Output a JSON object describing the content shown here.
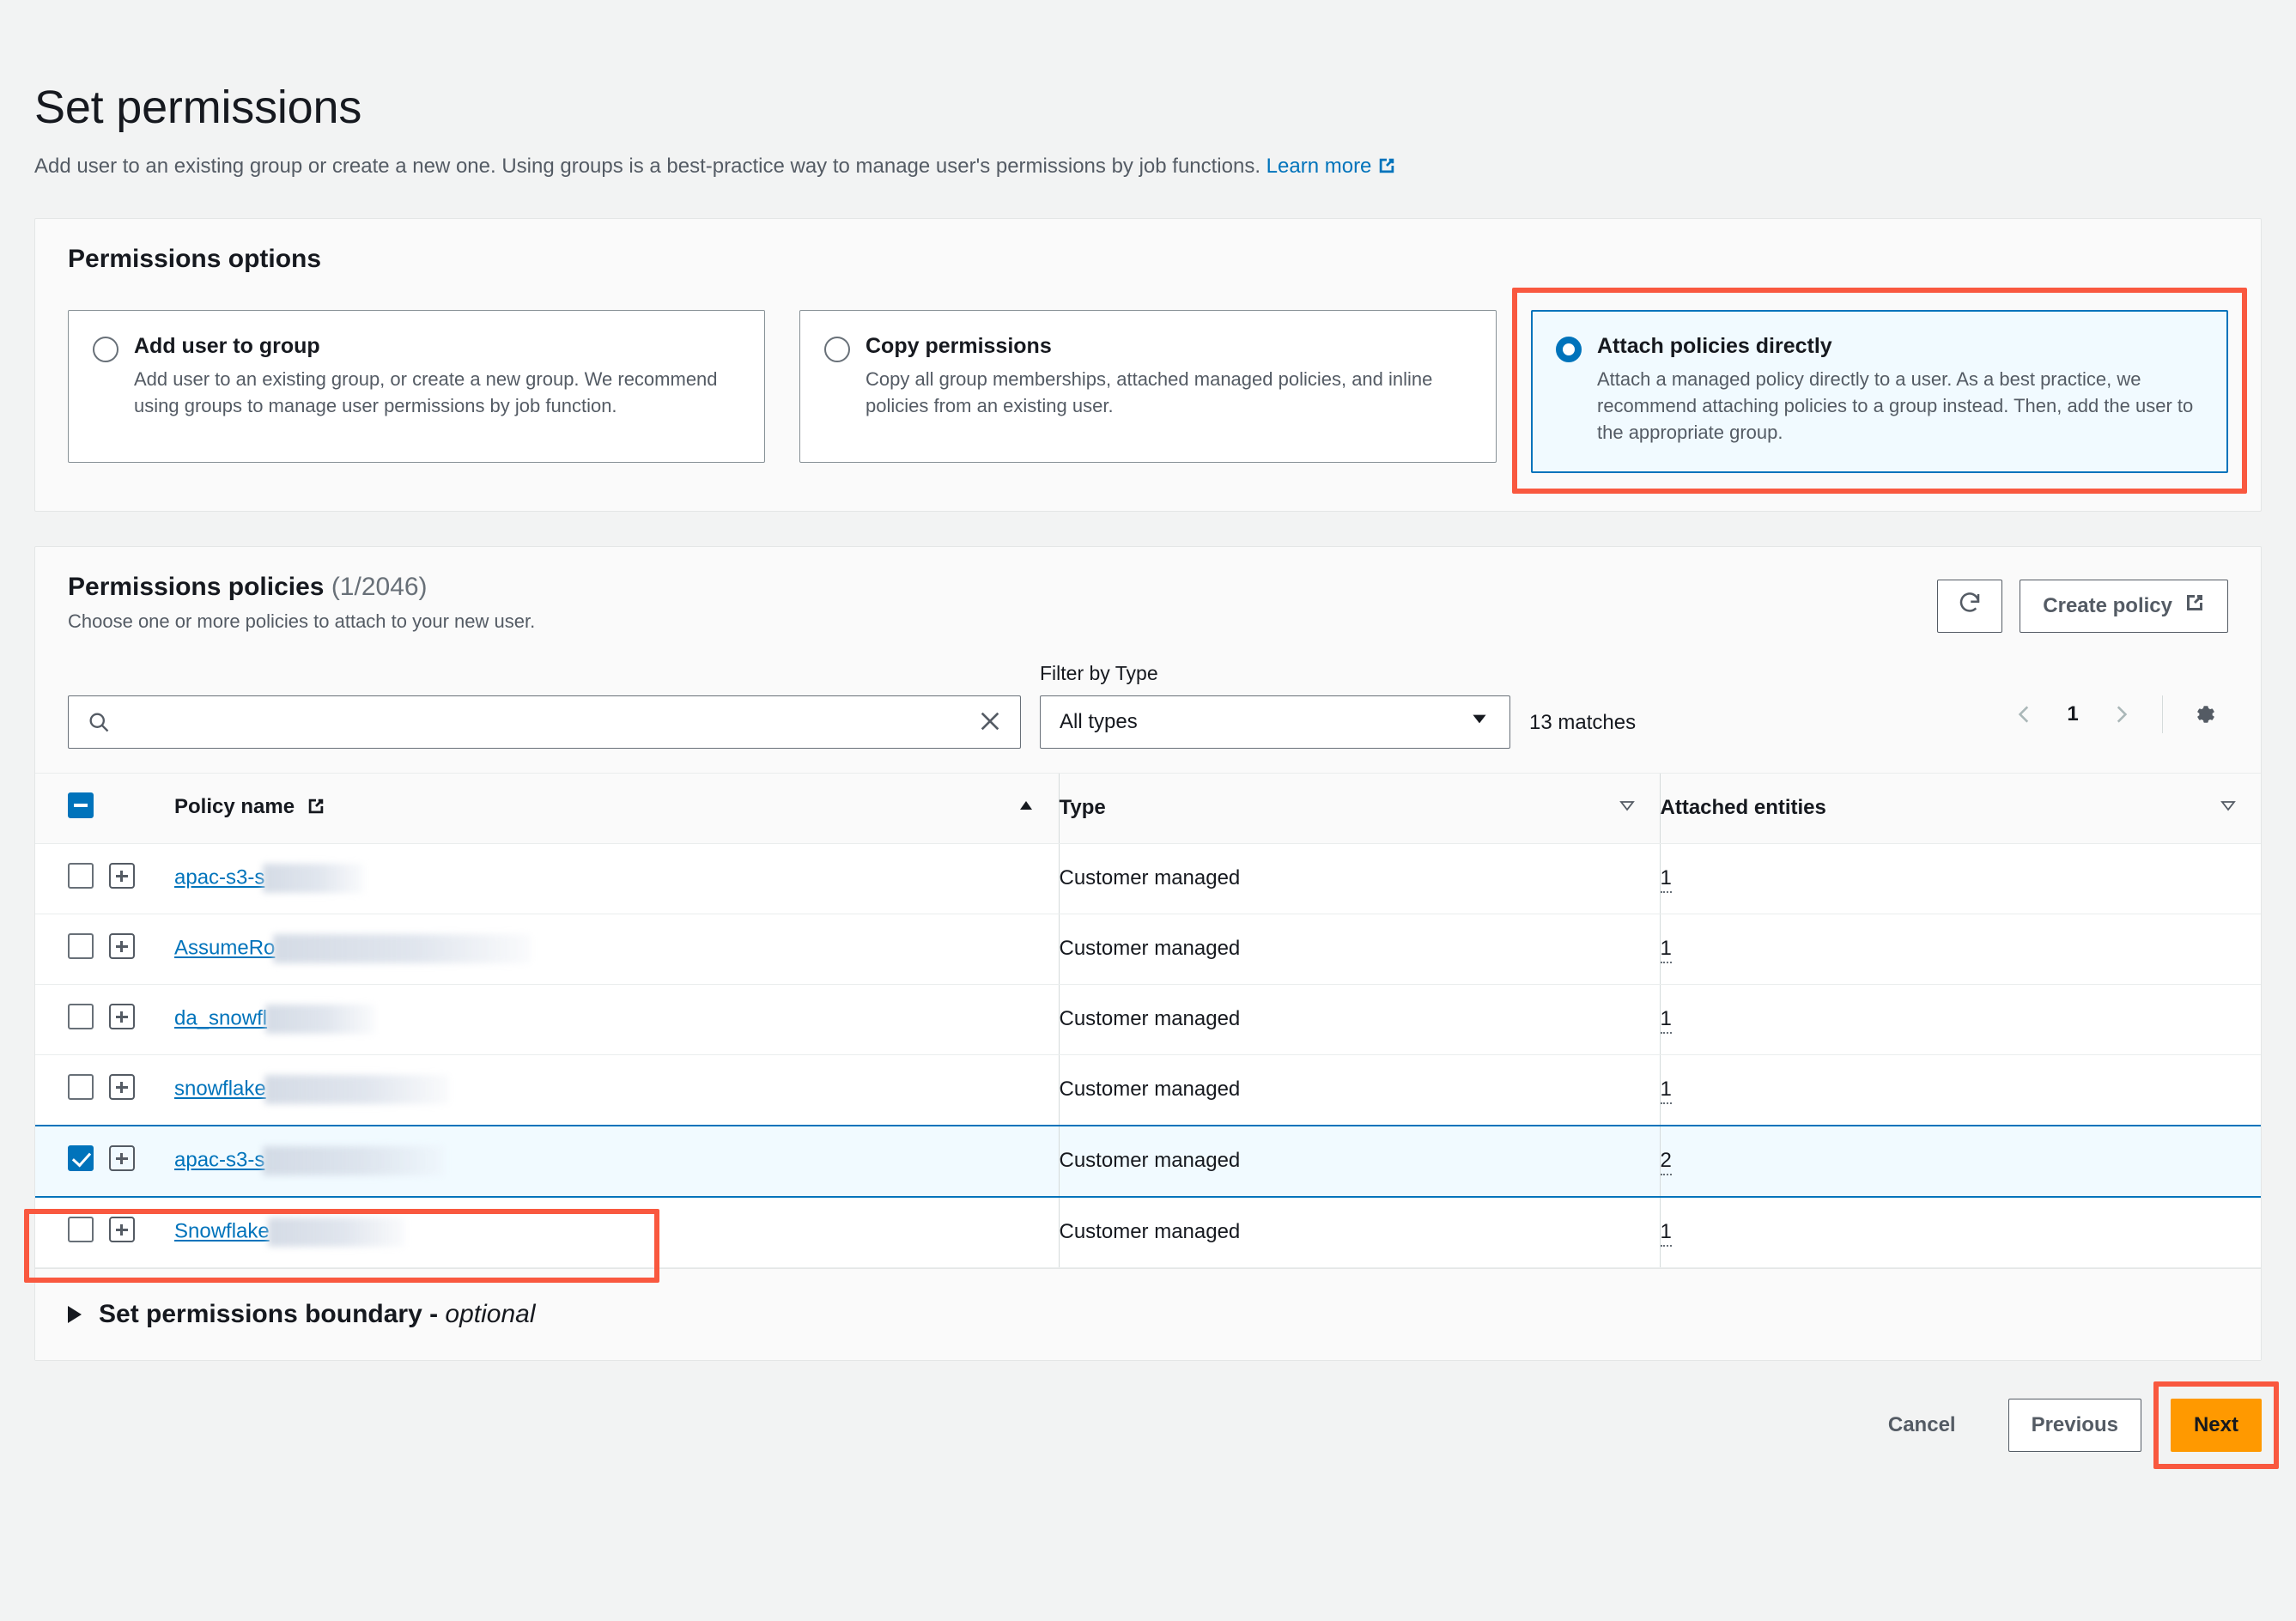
{
  "page": {
    "title": "Set permissions",
    "description": "Add user to an existing group or create a new one. Using groups is a best-practice way to manage user's permissions by job functions.",
    "learn_more": "Learn more"
  },
  "permissions_options": {
    "heading": "Permissions options",
    "selected": "attach-policies-directly",
    "options": [
      {
        "id": "add-user-to-group",
        "title": "Add user to group",
        "description": "Add user to an existing group, or create a new group. We recommend using groups to manage user permissions by job function.",
        "selected": false
      },
      {
        "id": "copy-permissions",
        "title": "Copy permissions",
        "description": "Copy all group memberships, attached managed policies, and inline policies from an existing user.",
        "selected": false
      },
      {
        "id": "attach-policies-directly",
        "title": "Attach policies directly",
        "description": "Attach a managed policy directly to a user. As a best practice, we recommend attaching policies to a group instead. Then, add the user to the appropriate group.",
        "selected": true
      }
    ]
  },
  "policies": {
    "heading": "Permissions policies",
    "counter": "(1/2046)",
    "subtitle": "Choose one or more policies to attach to your new user.",
    "refresh_label": "refresh-icon",
    "create_policy_label": "Create policy",
    "search": {
      "value": "",
      "placeholder": ""
    },
    "filter": {
      "label": "Filter by Type",
      "value": "All types"
    },
    "matches": "13 matches",
    "pagination": {
      "page": "1"
    },
    "columns": {
      "policy_name": "Policy name",
      "type": "Type",
      "attached_entities": "Attached entities"
    },
    "rows": [
      {
        "name_visible": "apac-s3-s",
        "redacted_width": 118,
        "type": "Customer managed",
        "attached": "1",
        "checked": false,
        "highlighted": false
      },
      {
        "name_visible": "AssumeRo",
        "redacted_width": 300,
        "type": "Customer managed",
        "attached": "1",
        "checked": false,
        "highlighted": false
      },
      {
        "name_visible": "da_snowfl",
        "redacted_width": 128,
        "type": "Customer managed",
        "attached": "1",
        "checked": false,
        "highlighted": false
      },
      {
        "name_visible": "snowflake",
        "redacted_width": 215,
        "type": "Customer managed",
        "attached": "1",
        "checked": false,
        "highlighted": false
      },
      {
        "name_visible": "apac-s3-s",
        "redacted_width": 212,
        "type": "Customer managed",
        "attached": "2",
        "checked": true,
        "highlighted": true
      },
      {
        "name_visible": "Snowflake",
        "redacted_width": 160,
        "type": "Customer managed",
        "attached": "1",
        "checked": false,
        "highlighted": false
      }
    ]
  },
  "boundary": {
    "title": "Set permissions boundary - ",
    "optional": "optional"
  },
  "footer": {
    "cancel": "Cancel",
    "previous": "Previous",
    "next": "Next"
  },
  "colors": {
    "accent": "#0073bb",
    "primary_button": "#ff9900",
    "annotation": "#f9583f"
  }
}
